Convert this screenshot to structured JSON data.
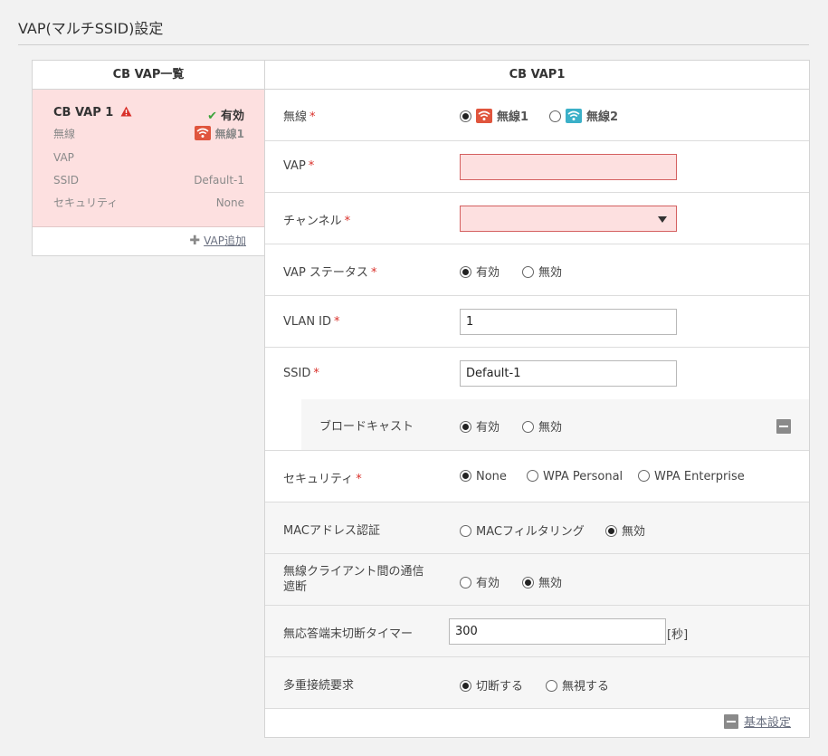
{
  "page": {
    "title": "VAP(マルチSSID)設定"
  },
  "list_panel": {
    "header": "CB VAP一覧",
    "card": {
      "name": "CB VAP 1",
      "status": "有効",
      "labels": {
        "wireless": "無線",
        "vap": "VAP",
        "ssid": "SSID",
        "security": "セキュリティ"
      },
      "values": {
        "wireless": "無線1",
        "vap": "",
        "ssid": "Default-1",
        "security": "None"
      }
    },
    "add_label": "VAP追加"
  },
  "form": {
    "header": "CB VAP1",
    "required_mark": "*",
    "wireless": {
      "label": "無線",
      "options": [
        "無線1",
        "無線2"
      ],
      "selected": "無線1"
    },
    "vap": {
      "label": "VAP",
      "value": ""
    },
    "channel": {
      "label": "チャンネル",
      "value": ""
    },
    "vap_status": {
      "label": "VAP ステータス",
      "options": [
        "有効",
        "無効"
      ],
      "selected": "有効"
    },
    "vlan_id": {
      "label": "VLAN ID",
      "value": "1"
    },
    "ssid": {
      "label": "SSID",
      "value": "Default-1"
    },
    "broadcast": {
      "label": "ブロードキャスト",
      "options": [
        "有効",
        "無効"
      ],
      "selected": "有効"
    },
    "security": {
      "label": "セキュリティ",
      "options": [
        "None",
        "WPA Personal",
        "WPA Enterprise"
      ],
      "selected": "None"
    },
    "mac_auth": {
      "label": "MACアドレス認証",
      "options": [
        "MACフィルタリング",
        "無効"
      ],
      "selected": "無効"
    },
    "client_isolation": {
      "label_line1": "無線クライアント間の通信",
      "label_line2": "遮断",
      "options": [
        "有効",
        "無効"
      ],
      "selected": "無効"
    },
    "timeout": {
      "label": "無応答端末切断タイマー",
      "value": "300",
      "unit": "[秒]"
    },
    "multi_conn": {
      "label": "多重接続要求",
      "options": [
        "切断する",
        "無視する"
      ],
      "selected": "切断する"
    },
    "basic_settings_label": "基本設定"
  },
  "colors": {
    "error_bg": "#fde0e0",
    "required": "#d9302a",
    "wifi1": "#e0553d",
    "wifi2": "#3bb0c8"
  }
}
